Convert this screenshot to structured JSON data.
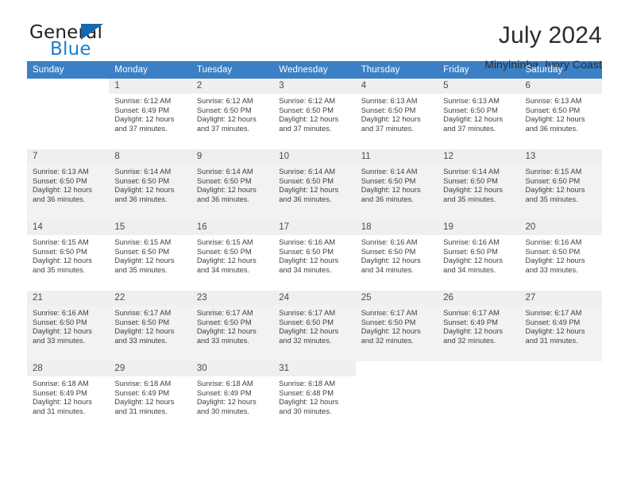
{
  "brand": {
    "name_top": "General",
    "name_bottom": "Blue",
    "logo_color": "#1268b3",
    "accent_color": "#1b7fd0"
  },
  "header": {
    "title": "July 2024",
    "subtitle": "Minyininba, Ivory Coast"
  },
  "calendar": {
    "header_bg": "#3b7fc4",
    "weekdays": [
      "Sunday",
      "Monday",
      "Tuesday",
      "Wednesday",
      "Thursday",
      "Friday",
      "Saturday"
    ],
    "weeks": [
      [
        {
          "day": "",
          "sunrise": "",
          "sunset": "",
          "daylight1": "",
          "daylight2": ""
        },
        {
          "day": "1",
          "sunrise": "Sunrise: 6:12 AM",
          "sunset": "Sunset: 6:49 PM",
          "daylight1": "Daylight: 12 hours",
          "daylight2": "and 37 minutes."
        },
        {
          "day": "2",
          "sunrise": "Sunrise: 6:12 AM",
          "sunset": "Sunset: 6:50 PM",
          "daylight1": "Daylight: 12 hours",
          "daylight2": "and 37 minutes."
        },
        {
          "day": "3",
          "sunrise": "Sunrise: 6:12 AM",
          "sunset": "Sunset: 6:50 PM",
          "daylight1": "Daylight: 12 hours",
          "daylight2": "and 37 minutes."
        },
        {
          "day": "4",
          "sunrise": "Sunrise: 6:13 AM",
          "sunset": "Sunset: 6:50 PM",
          "daylight1": "Daylight: 12 hours",
          "daylight2": "and 37 minutes."
        },
        {
          "day": "5",
          "sunrise": "Sunrise: 6:13 AM",
          "sunset": "Sunset: 6:50 PM",
          "daylight1": "Daylight: 12 hours",
          "daylight2": "and 37 minutes."
        },
        {
          "day": "6",
          "sunrise": "Sunrise: 6:13 AM",
          "sunset": "Sunset: 6:50 PM",
          "daylight1": "Daylight: 12 hours",
          "daylight2": "and 36 minutes."
        }
      ],
      [
        {
          "day": "7",
          "sunrise": "Sunrise: 6:13 AM",
          "sunset": "Sunset: 6:50 PM",
          "daylight1": "Daylight: 12 hours",
          "daylight2": "and 36 minutes."
        },
        {
          "day": "8",
          "sunrise": "Sunrise: 6:14 AM",
          "sunset": "Sunset: 6:50 PM",
          "daylight1": "Daylight: 12 hours",
          "daylight2": "and 36 minutes."
        },
        {
          "day": "9",
          "sunrise": "Sunrise: 6:14 AM",
          "sunset": "Sunset: 6:50 PM",
          "daylight1": "Daylight: 12 hours",
          "daylight2": "and 36 minutes."
        },
        {
          "day": "10",
          "sunrise": "Sunrise: 6:14 AM",
          "sunset": "Sunset: 6:50 PM",
          "daylight1": "Daylight: 12 hours",
          "daylight2": "and 36 minutes."
        },
        {
          "day": "11",
          "sunrise": "Sunrise: 6:14 AM",
          "sunset": "Sunset: 6:50 PM",
          "daylight1": "Daylight: 12 hours",
          "daylight2": "and 36 minutes."
        },
        {
          "day": "12",
          "sunrise": "Sunrise: 6:14 AM",
          "sunset": "Sunset: 6:50 PM",
          "daylight1": "Daylight: 12 hours",
          "daylight2": "and 35 minutes."
        },
        {
          "day": "13",
          "sunrise": "Sunrise: 6:15 AM",
          "sunset": "Sunset: 6:50 PM",
          "daylight1": "Daylight: 12 hours",
          "daylight2": "and 35 minutes."
        }
      ],
      [
        {
          "day": "14",
          "sunrise": "Sunrise: 6:15 AM",
          "sunset": "Sunset: 6:50 PM",
          "daylight1": "Daylight: 12 hours",
          "daylight2": "and 35 minutes."
        },
        {
          "day": "15",
          "sunrise": "Sunrise: 6:15 AM",
          "sunset": "Sunset: 6:50 PM",
          "daylight1": "Daylight: 12 hours",
          "daylight2": "and 35 minutes."
        },
        {
          "day": "16",
          "sunrise": "Sunrise: 6:15 AM",
          "sunset": "Sunset: 6:50 PM",
          "daylight1": "Daylight: 12 hours",
          "daylight2": "and 34 minutes."
        },
        {
          "day": "17",
          "sunrise": "Sunrise: 6:16 AM",
          "sunset": "Sunset: 6:50 PM",
          "daylight1": "Daylight: 12 hours",
          "daylight2": "and 34 minutes."
        },
        {
          "day": "18",
          "sunrise": "Sunrise: 6:16 AM",
          "sunset": "Sunset: 6:50 PM",
          "daylight1": "Daylight: 12 hours",
          "daylight2": "and 34 minutes."
        },
        {
          "day": "19",
          "sunrise": "Sunrise: 6:16 AM",
          "sunset": "Sunset: 6:50 PM",
          "daylight1": "Daylight: 12 hours",
          "daylight2": "and 34 minutes."
        },
        {
          "day": "20",
          "sunrise": "Sunrise: 6:16 AM",
          "sunset": "Sunset: 6:50 PM",
          "daylight1": "Daylight: 12 hours",
          "daylight2": "and 33 minutes."
        }
      ],
      [
        {
          "day": "21",
          "sunrise": "Sunrise: 6:16 AM",
          "sunset": "Sunset: 6:50 PM",
          "daylight1": "Daylight: 12 hours",
          "daylight2": "and 33 minutes."
        },
        {
          "day": "22",
          "sunrise": "Sunrise: 6:17 AM",
          "sunset": "Sunset: 6:50 PM",
          "daylight1": "Daylight: 12 hours",
          "daylight2": "and 33 minutes."
        },
        {
          "day": "23",
          "sunrise": "Sunrise: 6:17 AM",
          "sunset": "Sunset: 6:50 PM",
          "daylight1": "Daylight: 12 hours",
          "daylight2": "and 33 minutes."
        },
        {
          "day": "24",
          "sunrise": "Sunrise: 6:17 AM",
          "sunset": "Sunset: 6:50 PM",
          "daylight1": "Daylight: 12 hours",
          "daylight2": "and 32 minutes."
        },
        {
          "day": "25",
          "sunrise": "Sunrise: 6:17 AM",
          "sunset": "Sunset: 6:50 PM",
          "daylight1": "Daylight: 12 hours",
          "daylight2": "and 32 minutes."
        },
        {
          "day": "26",
          "sunrise": "Sunrise: 6:17 AM",
          "sunset": "Sunset: 6:49 PM",
          "daylight1": "Daylight: 12 hours",
          "daylight2": "and 32 minutes."
        },
        {
          "day": "27",
          "sunrise": "Sunrise: 6:17 AM",
          "sunset": "Sunset: 6:49 PM",
          "daylight1": "Daylight: 12 hours",
          "daylight2": "and 31 minutes."
        }
      ],
      [
        {
          "day": "28",
          "sunrise": "Sunrise: 6:18 AM",
          "sunset": "Sunset: 6:49 PM",
          "daylight1": "Daylight: 12 hours",
          "daylight2": "and 31 minutes."
        },
        {
          "day": "29",
          "sunrise": "Sunrise: 6:18 AM",
          "sunset": "Sunset: 6:49 PM",
          "daylight1": "Daylight: 12 hours",
          "daylight2": "and 31 minutes."
        },
        {
          "day": "30",
          "sunrise": "Sunrise: 6:18 AM",
          "sunset": "Sunset: 6:49 PM",
          "daylight1": "Daylight: 12 hours",
          "daylight2": "and 30 minutes."
        },
        {
          "day": "31",
          "sunrise": "Sunrise: 6:18 AM",
          "sunset": "Sunset: 6:48 PM",
          "daylight1": "Daylight: 12 hours",
          "daylight2": "and 30 minutes."
        },
        {
          "day": "",
          "sunrise": "",
          "sunset": "",
          "daylight1": "",
          "daylight2": ""
        },
        {
          "day": "",
          "sunrise": "",
          "sunset": "",
          "daylight1": "",
          "daylight2": ""
        },
        {
          "day": "",
          "sunrise": "",
          "sunset": "",
          "daylight1": "",
          "daylight2": ""
        }
      ]
    ]
  }
}
